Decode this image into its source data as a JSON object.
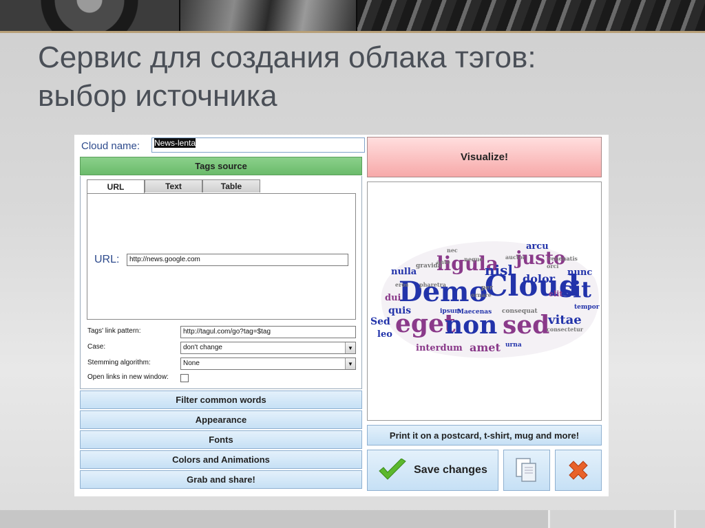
{
  "slide": {
    "title_line1": "Сервис для создания облака тэгов:",
    "title_line2": "выбор источника"
  },
  "app": {
    "cloud_name_label": "Cloud name:",
    "cloud_name_value": "News-lenta",
    "tags_source_header": "Tags source",
    "tabs": [
      {
        "label": "URL",
        "active": true
      },
      {
        "label": "Text",
        "active": false
      },
      {
        "label": "Table",
        "active": false
      }
    ],
    "url_label": "URL:",
    "url_value": "http://news.google.com",
    "fields": {
      "link_pattern_label": "Tags' link pattern:",
      "link_pattern_value": "http://tagul.com/go?tag=$tag",
      "case_label": "Case:",
      "case_value": "don't change",
      "stemming_label": "Stemming algorithm:",
      "stemming_value": "None",
      "open_links_label": "Open links in new window:",
      "open_links_checked": false
    },
    "sections": [
      "Filter common words",
      "Appearance",
      "Fonts",
      "Colors and Animations",
      "Grab and share!"
    ],
    "visualize_label": "Visualize!",
    "print_label": "Print it on a postcard, t-shirt, mug and more!",
    "save_label": "Save changes",
    "icons": {
      "save": "checkmark-icon",
      "copy": "copy-icon",
      "delete": "close-icon"
    },
    "cloud_words": [
      "Demo",
      "Cloud",
      "sit",
      "eget",
      "non",
      "sed",
      "ligula",
      "justo",
      "nisl",
      "dolor",
      "vitae",
      "amet",
      "interdum",
      "arcu",
      "nulla",
      "quis",
      "dui",
      "nunc",
      "Sed",
      "elit",
      "gravida",
      "ipsum",
      "Maecenas",
      "consequat",
      "tempor",
      "urna",
      "consectetur",
      "leo",
      "ornare",
      "pharetra",
      "per",
      "eros",
      "orci",
      "auctor",
      "nec",
      "neque",
      "ante",
      "venenatis"
    ],
    "colors": {
      "cloud_blue": "#2233aa",
      "cloud_purple": "#8a3a8a",
      "cloud_gray": "#777777",
      "tags_header_green": "#6bbb6b",
      "visualize_red": "#f7a9a9"
    }
  }
}
